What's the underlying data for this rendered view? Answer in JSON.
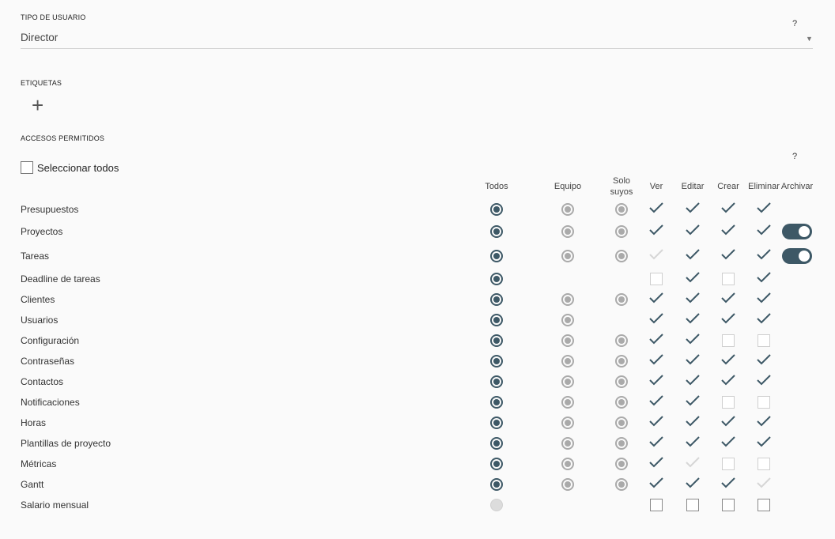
{
  "user_type": {
    "label": "TIPO DE USUARIO",
    "value": "Director",
    "help": "?",
    "arrow_icon": "caret-down-icon"
  },
  "tags": {
    "label": "ETIQUETAS",
    "add_icon": "plus-icon"
  },
  "access": {
    "label": "ACCESOS PERMITIDOS",
    "help": "?",
    "select_all_label": "Seleccionar todos",
    "select_all_checked": false
  },
  "columns": [
    {
      "key": "todos",
      "label": "Todos"
    },
    {
      "key": "equipo",
      "label": "Equipo"
    },
    {
      "key": "solo_suyos",
      "label": "Solo\nsuyos"
    },
    {
      "key": "ver",
      "label": "Ver"
    },
    {
      "key": "editar",
      "label": "Editar"
    },
    {
      "key": "crear",
      "label": "Crear"
    },
    {
      "key": "eliminar",
      "label": "Eliminar"
    },
    {
      "key": "archivar",
      "label": "Archivar"
    }
  ],
  "colors": {
    "accent": "#3d5866",
    "radio_off": "#aaaaaa",
    "check_light": "#d6d6d6"
  },
  "rows": [
    {
      "label": "Presupuestos",
      "todos": "on",
      "equipo": "off",
      "solo_suyos": "off",
      "ver": "check",
      "editar": "check",
      "crear": "check",
      "eliminar": "check",
      "archivar": null
    },
    {
      "label": "Proyectos",
      "todos": "on",
      "equipo": "off",
      "solo_suyos": "off",
      "ver": "check",
      "editar": "check",
      "crear": "check",
      "eliminar": "check",
      "archivar": "toggle-on"
    },
    {
      "label": "Tareas",
      "todos": "on",
      "equipo": "off",
      "solo_suyos": "off",
      "ver": "check-light",
      "editar": "check",
      "crear": "check",
      "eliminar": "check",
      "archivar": "toggle-on"
    },
    {
      "label": "Deadline de tareas",
      "todos": "on",
      "equipo": null,
      "solo_suyos": null,
      "ver": "empty",
      "editar": "check",
      "crear": "empty",
      "eliminar": "check",
      "archivar": null
    },
    {
      "label": "Clientes",
      "todos": "on",
      "equipo": "off",
      "solo_suyos": "off",
      "ver": "check",
      "editar": "check",
      "crear": "check",
      "eliminar": "check",
      "archivar": null
    },
    {
      "label": "Usuarios",
      "todos": "on",
      "equipo": "off",
      "solo_suyos": null,
      "ver": "check",
      "editar": "check",
      "crear": "check",
      "eliminar": "check",
      "archivar": null
    },
    {
      "label": "Configuración",
      "todos": "on",
      "equipo": "off",
      "solo_suyos": "off",
      "ver": "check",
      "editar": "check",
      "crear": "empty",
      "eliminar": "empty",
      "archivar": null
    },
    {
      "label": "Contraseñas",
      "todos": "on",
      "equipo": "off",
      "solo_suyos": "off",
      "ver": "check",
      "editar": "check",
      "crear": "check",
      "eliminar": "check",
      "archivar": null
    },
    {
      "label": "Contactos",
      "todos": "on",
      "equipo": "off",
      "solo_suyos": "off",
      "ver": "check",
      "editar": "check",
      "crear": "check",
      "eliminar": "check",
      "archivar": null
    },
    {
      "label": "Notificaciones",
      "todos": "on",
      "equipo": "off",
      "solo_suyos": "off",
      "ver": "check",
      "editar": "check",
      "crear": "empty",
      "eliminar": "empty",
      "archivar": null
    },
    {
      "label": "Horas",
      "todos": "on",
      "equipo": "off",
      "solo_suyos": "off",
      "ver": "check",
      "editar": "check",
      "crear": "check",
      "eliminar": "check",
      "archivar": null
    },
    {
      "label": "Plantillas de proyecto",
      "todos": "on",
      "equipo": "off",
      "solo_suyos": "off",
      "ver": "check",
      "editar": "check",
      "crear": "check",
      "eliminar": "check",
      "archivar": null
    },
    {
      "label": "Métricas",
      "todos": "on",
      "equipo": "off",
      "solo_suyos": "off",
      "ver": "check",
      "editar": "check-light",
      "crear": "empty",
      "eliminar": "empty",
      "archivar": null
    },
    {
      "label": "Gantt",
      "todos": "on",
      "equipo": "off",
      "solo_suyos": "off",
      "ver": "check",
      "editar": "check",
      "crear": "check",
      "eliminar": "check-light",
      "archivar": null
    },
    {
      "label": "Salario mensual",
      "todos": "dim",
      "equipo": null,
      "solo_suyos": null,
      "ver": "empty-strong",
      "editar": "empty-strong",
      "crear": "empty-strong",
      "eliminar": "empty-strong",
      "archivar": null
    }
  ]
}
